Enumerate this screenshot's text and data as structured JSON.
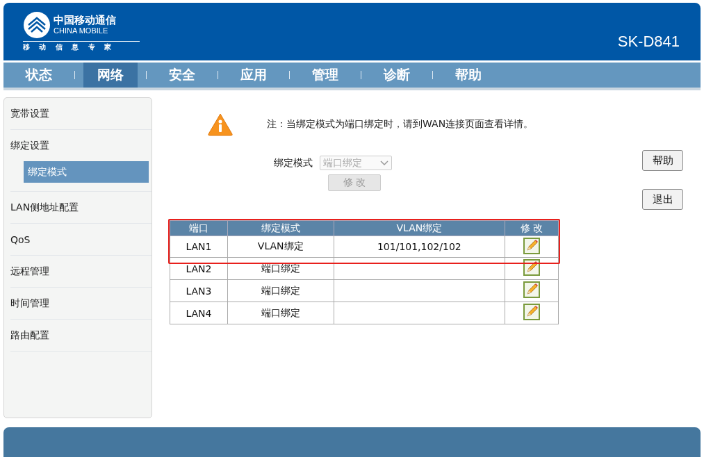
{
  "header": {
    "logo_cn": "中国移动通信",
    "logo_en": "CHINA MOBILE",
    "slogan": "移 动 信 息 专 家",
    "model": "SK-D841"
  },
  "nav": [
    {
      "label": "状态",
      "selected": false
    },
    {
      "label": "网络",
      "selected": true
    },
    {
      "label": "安全",
      "selected": false
    },
    {
      "label": "应用",
      "selected": false
    },
    {
      "label": "管理",
      "selected": false
    },
    {
      "label": "诊断",
      "selected": false
    },
    {
      "label": "帮助",
      "selected": false
    }
  ],
  "sidebar": {
    "items": [
      {
        "label": "宽带设置"
      },
      {
        "label": "绑定设置",
        "children": [
          {
            "label": "绑定模式",
            "selected": true
          }
        ]
      },
      {
        "label": "LAN侧地址配置"
      },
      {
        "label": "QoS"
      },
      {
        "label": "远程管理"
      },
      {
        "label": "时间管理"
      },
      {
        "label": "路由配置"
      }
    ]
  },
  "notice": "注：当绑定模式为端口绑定时，请到WAN连接页面查看详情。",
  "form": {
    "label": "绑定模式",
    "select_value": "端口绑定",
    "select_disabled": true,
    "modify_button": "修 改",
    "modify_disabled": true
  },
  "side_buttons": [
    "帮助",
    "退出"
  ],
  "table": {
    "highlight": true,
    "columns": [
      "端口",
      "绑定模式",
      "VLAN绑定",
      "修 改"
    ],
    "rows": [
      {
        "port": "LAN1",
        "mode": "VLAN绑定",
        "vlan": "101/101,102/102"
      },
      {
        "port": "LAN2",
        "mode": "端口绑定"
      },
      {
        "port": "LAN3",
        "mode": "端口绑定"
      },
      {
        "port": "LAN4",
        "mode": "端口绑定"
      }
    ]
  }
}
